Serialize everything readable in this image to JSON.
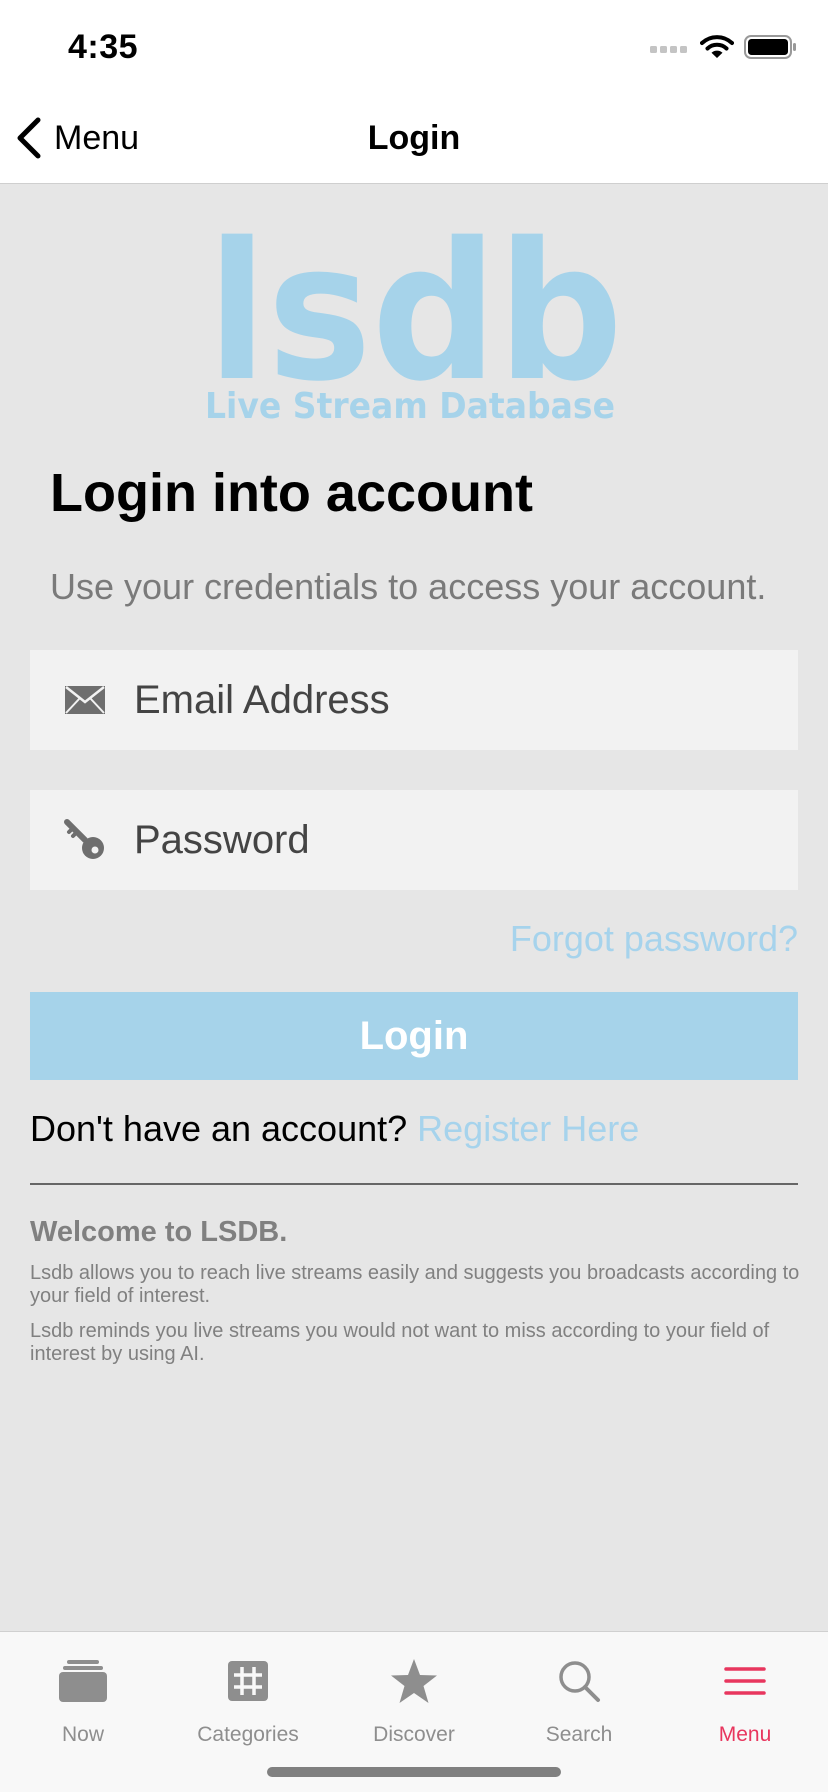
{
  "status_bar": {
    "time": "4:35"
  },
  "nav": {
    "back_label": "Menu",
    "title": "Login"
  },
  "logo": {
    "wordmark": "lsdb",
    "tagline": "Live Stream Database",
    "color": "#a6d3ea"
  },
  "login_form": {
    "heading": "Login into account",
    "subtitle": "Use your credentials to access your account.",
    "email": {
      "placeholder": "Email Address",
      "value": "",
      "icon": "envelope-icon"
    },
    "password": {
      "placeholder": "Password",
      "value": "",
      "icon": "key-icon"
    },
    "forgot_label": "Forgot password?",
    "submit_label": "Login",
    "register_prompt": "Don't have an account?",
    "register_label": "Register Here"
  },
  "welcome": {
    "title": "Welcome to LSDB.",
    "paragraphs": [
      "Lsdb allows you to reach live streams easily and suggests you broadcasts according to your field of interest.",
      "Lsdb reminds you live streams you would not want to miss according to your field of interest by using AI."
    ]
  },
  "tab_bar": {
    "active_color": "#e8365e",
    "inactive_color": "#8e8e8e",
    "items": [
      {
        "label": "Now",
        "icon": "stack-icon",
        "active": false
      },
      {
        "label": "Categories",
        "icon": "grid-icon",
        "active": false
      },
      {
        "label": "Discover",
        "icon": "star-icon",
        "active": false
      },
      {
        "label": "Search",
        "icon": "search-icon",
        "active": false
      },
      {
        "label": "Menu",
        "icon": "hamburger-menu-icon",
        "active": true
      }
    ]
  }
}
